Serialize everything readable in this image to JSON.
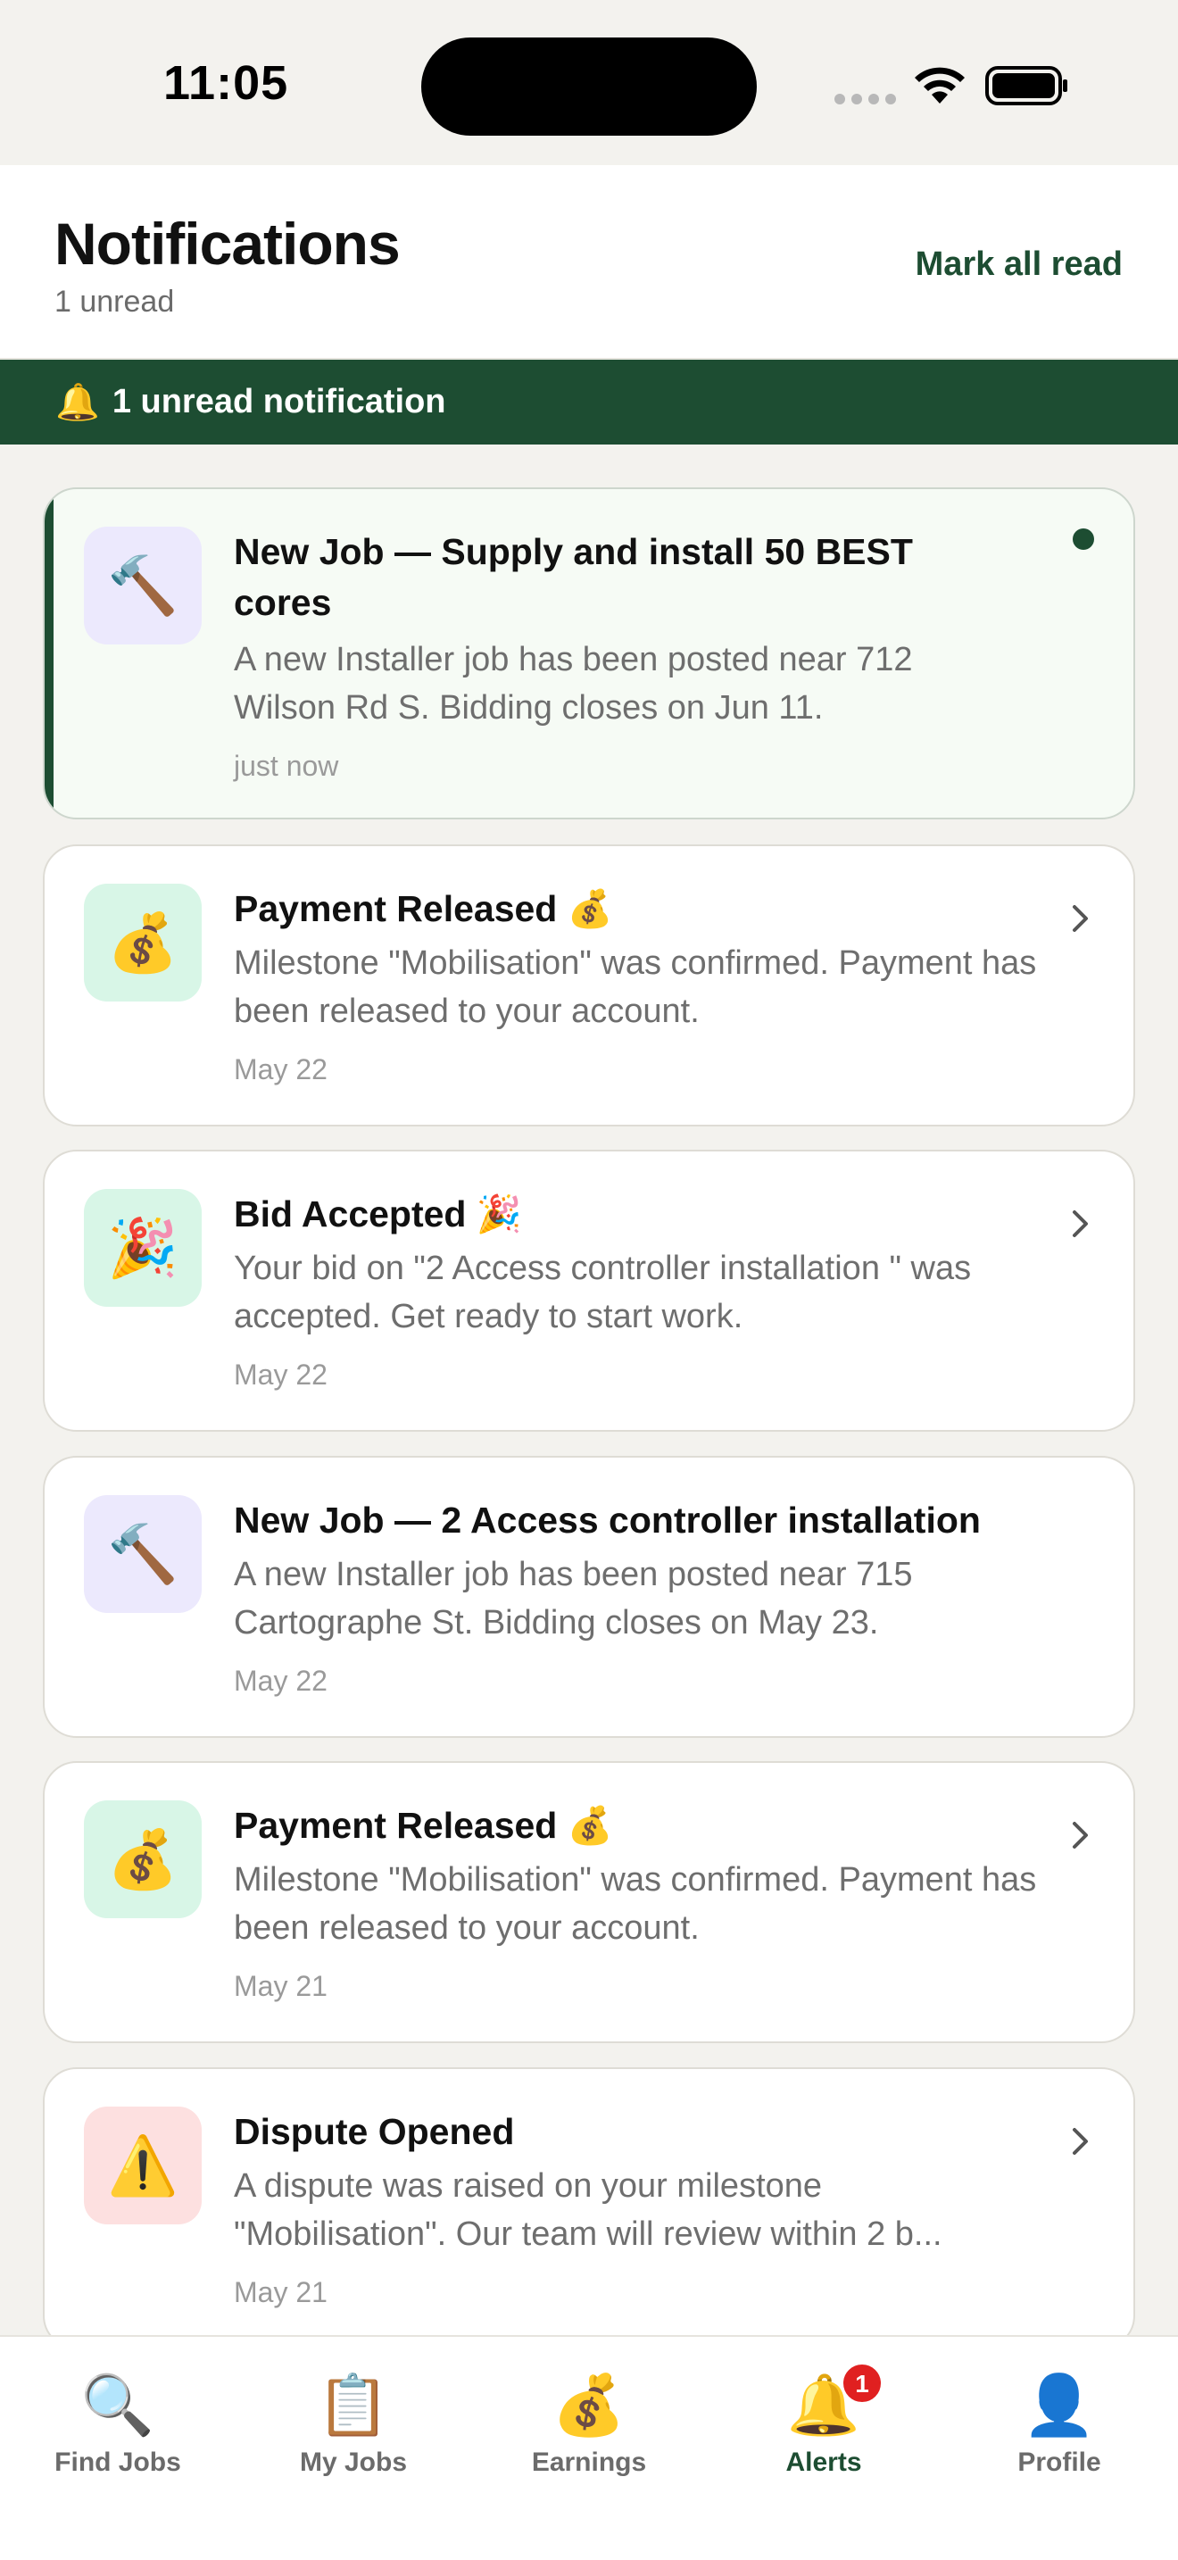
{
  "status_bar": {
    "time": "11:05"
  },
  "header": {
    "title": "Notifications",
    "subtitle": "1 unread",
    "mark_all_label": "Mark all read"
  },
  "banner": {
    "icon": "🔔",
    "text": "1 unread notification"
  },
  "notifications": [
    {
      "icon": "🔨",
      "title": "New Job — Supply and install 50 BEST cores",
      "body": "A new Installer job has been posted near 712 Wilson Rd S. Bidding closes on Jun 11.",
      "time": "just now",
      "unread": true
    },
    {
      "icon": "💰",
      "title": "Payment Released 💰",
      "body": "Milestone \"Mobilisation\" was confirmed. Payment has been released to your account.",
      "time": "May 22",
      "unread": false
    },
    {
      "icon": "🎉",
      "title": "Bid Accepted 🎉",
      "body": "Your bid on \"2 Access controller installation \" was accepted. Get ready to start work.",
      "time": "May 22",
      "unread": false
    },
    {
      "icon": "🔨",
      "title": "New Job — 2 Access controller installation",
      "body": "A new Installer job has been posted near 715 Cartographe St. Bidding closes on May 23.",
      "time": "May 22",
      "unread": false
    },
    {
      "icon": "💰",
      "title": "Payment Released 💰",
      "body": "Milestone \"Mobilisation\" was confirmed. Payment has been released to your account.",
      "time": "May 21",
      "unread": false
    },
    {
      "icon": "⚠️",
      "title": "Dispute Opened",
      "body_line1": "A dispute was raised on your milestone",
      "body_line2": "\"Mobilisation\". Our team will review within 2 b...",
      "time": "May 21",
      "unread": false
    }
  ],
  "tabs": [
    {
      "icon": "🔍",
      "label": "Find Jobs"
    },
    {
      "icon": "📋",
      "label": "My Jobs"
    },
    {
      "icon": "💰",
      "label": "Earnings"
    },
    {
      "icon": "🔔",
      "label": "Alerts",
      "badge": "1",
      "active": true
    },
    {
      "icon": "👤",
      "label": "Profile"
    }
  ],
  "colors": {
    "brand": "#1d4d32",
    "badge": "#e02020",
    "background": "#f3f2ee"
  }
}
